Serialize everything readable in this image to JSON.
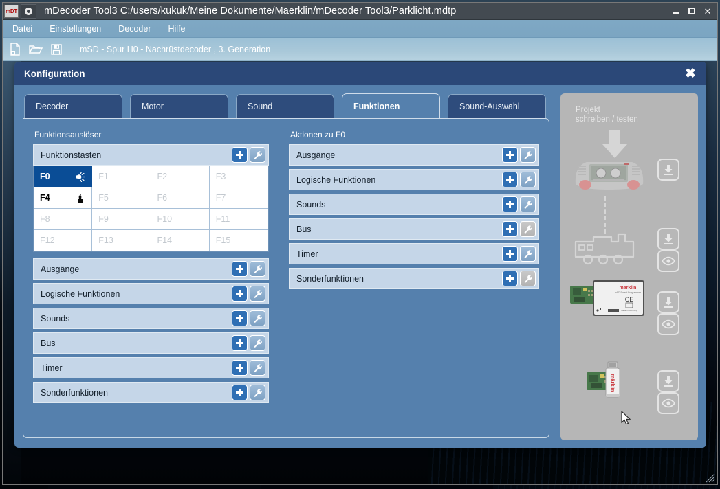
{
  "window": {
    "title": "mDecoder Tool3 C:/users/kukuk/Meine Dokumente/Maerklin/mDecoder Tool3/Parklicht.mdtp",
    "app_icon_label": "mDT",
    "controls": {
      "minimize": "minimize-icon",
      "maximize": "maximize-icon",
      "close": "close-icon"
    },
    "colors": {
      "titlebar": "#434a51",
      "menubar": "#7ba5c2",
      "accent": "#2b4878",
      "selection": "#0a4d96",
      "row": "#c5d6e8",
      "panel": "#5580ad"
    }
  },
  "menubar": {
    "items": [
      {
        "label": "Datei"
      },
      {
        "label": "Einstellungen"
      },
      {
        "label": "Decoder"
      },
      {
        "label": "Hilfe"
      }
    ]
  },
  "toolbar": {
    "icons": [
      {
        "name": "new-document-icon"
      },
      {
        "name": "open-folder-icon"
      },
      {
        "name": "save-disk-icon"
      }
    ],
    "status_text": "mSD - Spur H0 - Nachrüstdecoder , 3. Generation"
  },
  "konfiguration": {
    "title": "Konfiguration",
    "close_label": "✖",
    "tabs": [
      {
        "label": "Decoder",
        "active": false
      },
      {
        "label": "Motor",
        "active": false
      },
      {
        "label": "Sound",
        "active": false
      },
      {
        "label": "Funktionen",
        "active": true
      },
      {
        "label": "Sound-Auswahl",
        "active": false
      }
    ],
    "left": {
      "section_label": "Funktionsauslöser",
      "group_header": "Funktionstasten",
      "function_keys": [
        {
          "label": "F0",
          "state": "selected",
          "icon": "headlight-icon"
        },
        {
          "label": "F1",
          "state": "empty",
          "icon": ""
        },
        {
          "label": "F2",
          "state": "empty",
          "icon": ""
        },
        {
          "label": "F3",
          "state": "empty",
          "icon": ""
        },
        {
          "label": "F4",
          "state": "assigned",
          "icon": "smoke-generator-icon"
        },
        {
          "label": "F5",
          "state": "empty",
          "icon": ""
        },
        {
          "label": "F6",
          "state": "empty",
          "icon": ""
        },
        {
          "label": "F7",
          "state": "empty",
          "icon": ""
        },
        {
          "label": "F8",
          "state": "empty",
          "icon": ""
        },
        {
          "label": "F9",
          "state": "empty",
          "icon": ""
        },
        {
          "label": "F10",
          "state": "empty",
          "icon": ""
        },
        {
          "label": "F11",
          "state": "empty",
          "icon": ""
        },
        {
          "label": "F12",
          "state": "empty",
          "icon": ""
        },
        {
          "label": "F13",
          "state": "empty",
          "icon": ""
        },
        {
          "label": "F14",
          "state": "empty",
          "icon": ""
        },
        {
          "label": "F15",
          "state": "empty",
          "icon": ""
        }
      ],
      "rows": [
        {
          "label": "Ausgänge",
          "wrench_enabled": true
        },
        {
          "label": "Logische Funktionen",
          "wrench_enabled": true
        },
        {
          "label": "Sounds",
          "wrench_enabled": true
        },
        {
          "label": "Bus",
          "wrench_enabled": true
        },
        {
          "label": "Timer",
          "wrench_enabled": true
        },
        {
          "label": "Sonderfunktionen",
          "wrench_enabled": true
        }
      ]
    },
    "right": {
      "section_label": "Aktionen zu F0",
      "rows": [
        {
          "label": "Ausgänge",
          "wrench_enabled": true
        },
        {
          "label": "Logische Funktionen",
          "wrench_enabled": true
        },
        {
          "label": "Sounds",
          "wrench_enabled": true
        },
        {
          "label": "Bus",
          "wrench_enabled": false
        },
        {
          "label": "Timer",
          "wrench_enabled": true
        },
        {
          "label": "Sonderfunktionen",
          "wrench_enabled": false
        }
      ]
    },
    "project_panel": {
      "title_line1": "Projekt",
      "title_line2": "schreiben / testen",
      "disabled": true,
      "devices": [
        {
          "name": "central-station-device",
          "buttons": [
            "write-icon"
          ]
        },
        {
          "name": "locomotive-device",
          "buttons": [
            "write-icon",
            "read-icon"
          ]
        },
        {
          "name": "msd-sound-programmer-device",
          "brand": "märklin",
          "buttons": [
            "write-icon",
            "read-icon"
          ]
        },
        {
          "name": "usb-programmer-stick-device",
          "brand": "märklin",
          "buttons": [
            "write-icon",
            "read-icon"
          ]
        }
      ]
    }
  }
}
